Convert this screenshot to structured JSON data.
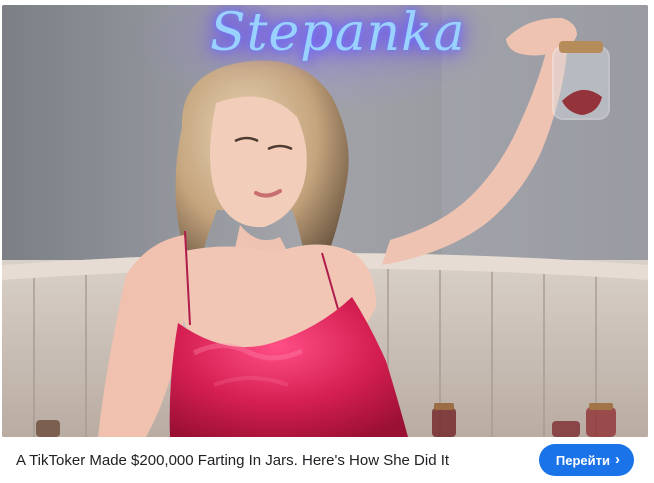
{
  "ad": {
    "image": {
      "neon_sign_text": "Stepanka"
    },
    "headline": "A TikToker Made $200,000 Farting In Jars. Here's How She Did It",
    "cta": {
      "label": "Перейти",
      "icon": "chevron-right-icon",
      "color": "#1a73e8"
    }
  }
}
